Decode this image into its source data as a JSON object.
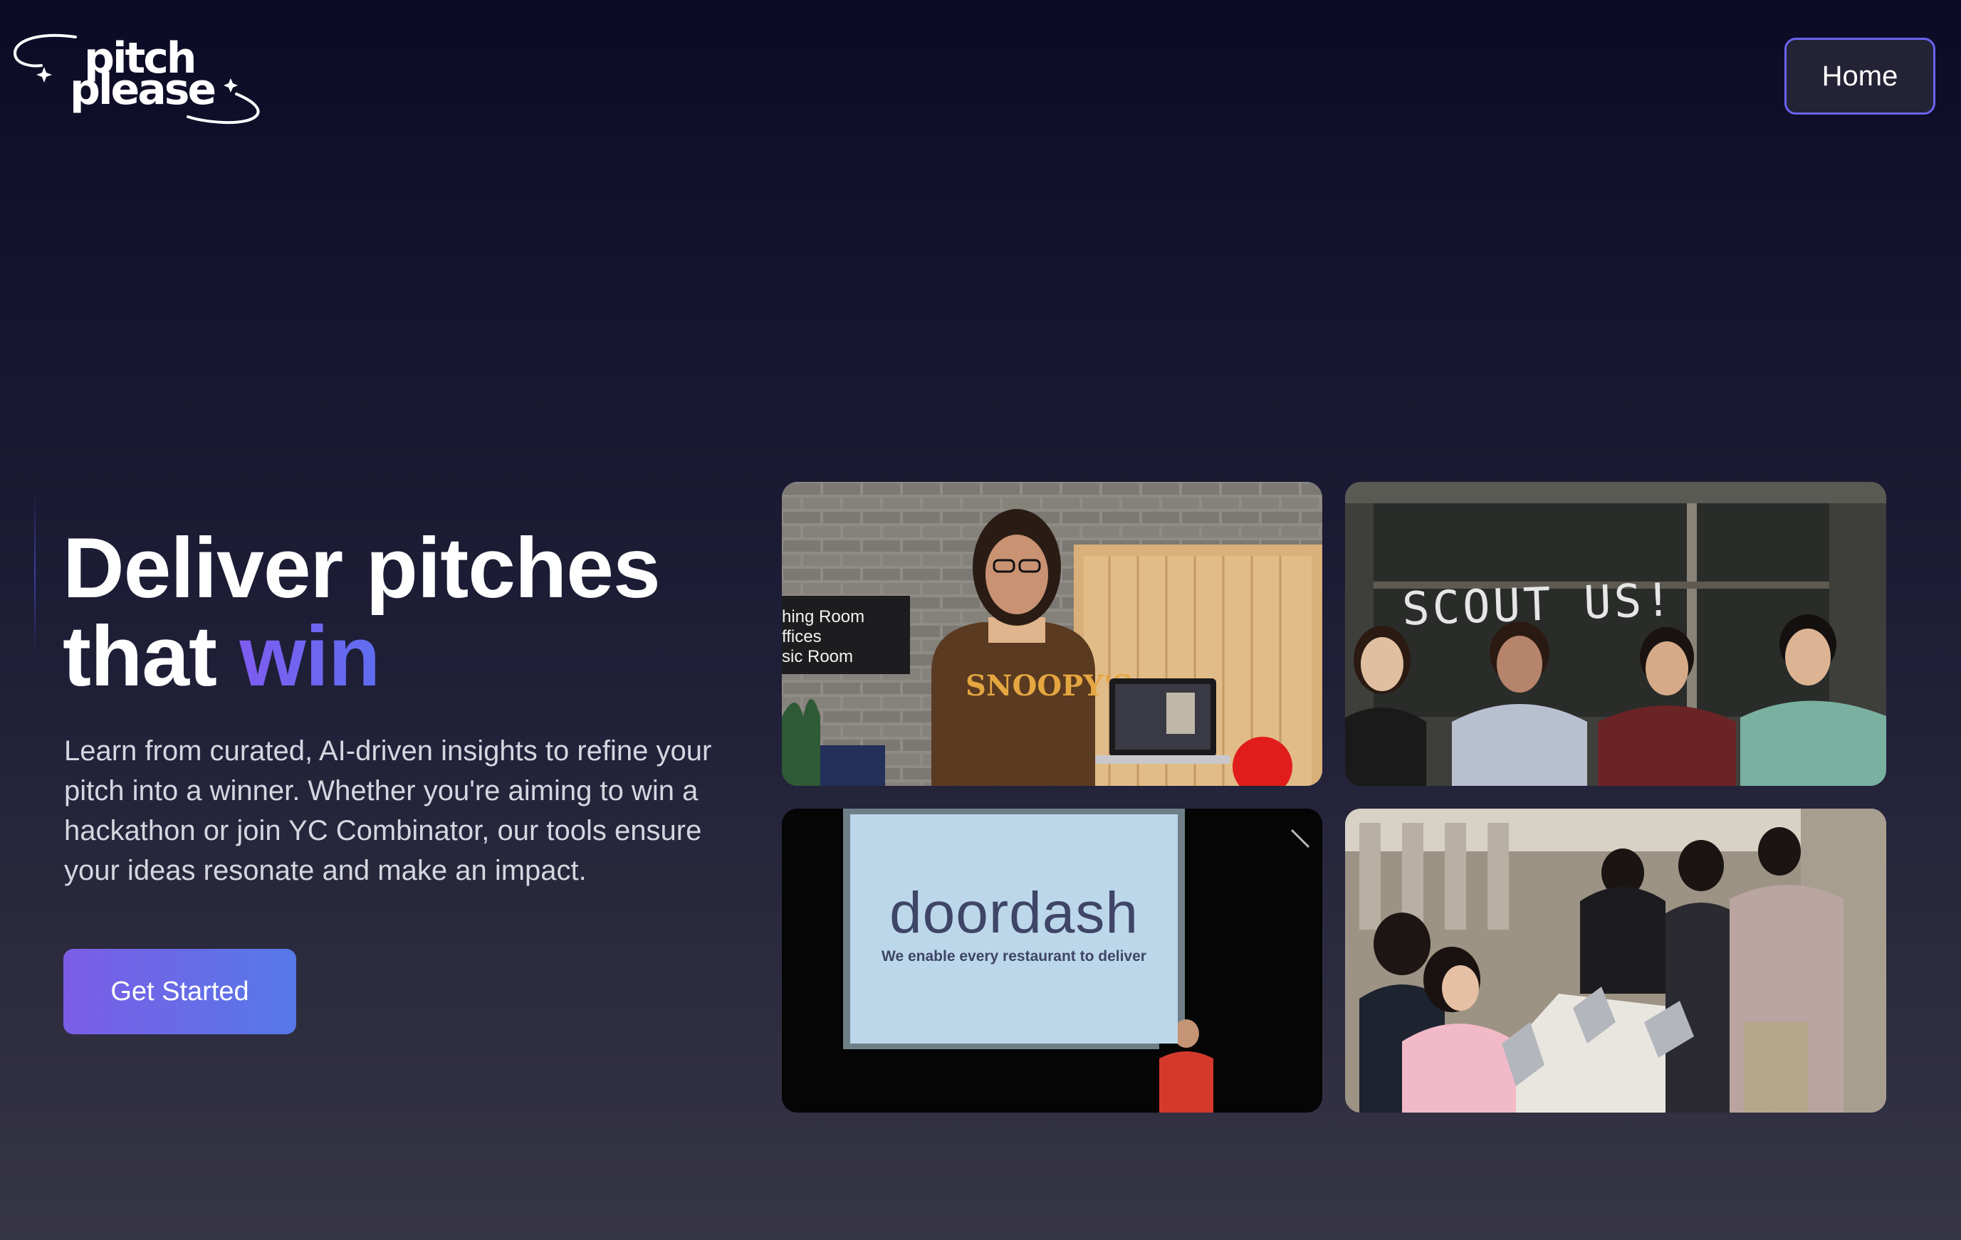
{
  "logo": {
    "line1": "pitch",
    "line2": "please"
  },
  "nav": {
    "home_label": "Home"
  },
  "hero": {
    "title_part1": "Deliver pitches",
    "title_part2": "that ",
    "title_accent": "win",
    "description": "Learn from curated, AI-driven insights to refine your pitch into a winner. Whether you're aiming to win a hackathon or join YC Combinator, our tools ensure your ideas resonate and make an impact.",
    "cta_label": "Get Started"
  },
  "gallery": {
    "photo1": {
      "sign_lines": [
        "hing Room",
        "ffices",
        "sic Room"
      ],
      "shirt_text": "SNOOPY'S"
    },
    "photo2": {
      "chalk_text": "SCOUT US!"
    },
    "photo3": {
      "slide_title": "doordash",
      "slide_subtitle": "We enable every restaurant to deliver"
    },
    "photo4": {}
  },
  "colors": {
    "background_top": "#0b0b26",
    "background_bottom": "#363545",
    "accent_purple": "#7e5cf0",
    "accent_blue": "#5679e8",
    "nav_border": "#6b63f0"
  }
}
